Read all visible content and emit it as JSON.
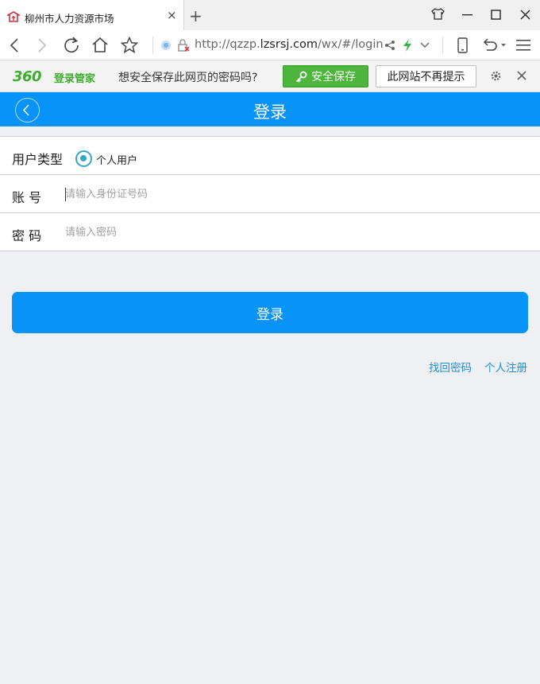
{
  "browser": {
    "tab_title": "柳州市人力资源市场",
    "tab_close": "×",
    "new_tab": "+",
    "url_prefix": "http://qzzp.",
    "url_domain": "lzsrsj.com",
    "url_path": "/wx/#/login"
  },
  "password_bar": {
    "logo": "360",
    "logo_text": "登录管家",
    "question": "想安全保存此网页的密码吗?",
    "save_button": "安全保存",
    "no_prompt_button": "此网站不再提示"
  },
  "header": {
    "title": "登录"
  },
  "form": {
    "user_type_label": "用户类型",
    "user_type_option": "个人用户",
    "account_label": "账 号",
    "account_placeholder": "请输入身份证号码",
    "password_label": "密 码",
    "password_placeholder": "请输入密码"
  },
  "login_button": "登录",
  "links": {
    "recover_password": "找回密码",
    "register": "个人注册"
  },
  "colors": {
    "brand_blue": "#0793f8",
    "radio_accent": "#34a6c6",
    "green_360": "#4bb53c",
    "link_blue": "#1d8fd6"
  }
}
